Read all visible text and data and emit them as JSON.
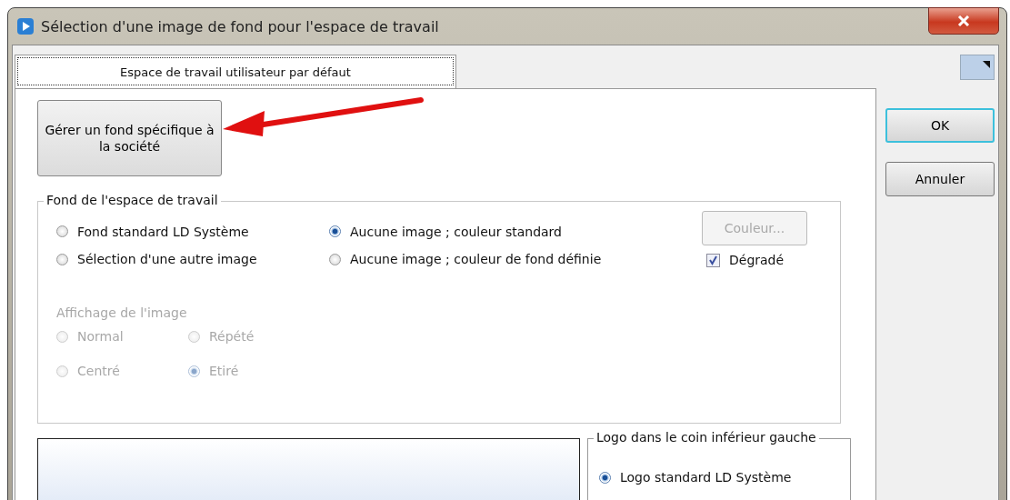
{
  "window": {
    "title": "Sélection d'une image de fond pour l'espace de travail"
  },
  "tabs": [
    {
      "label": "Espace de travail utilisateur par défaut",
      "selected": true
    }
  ],
  "manage_button": {
    "label": "Gérer un fond spécifique à la société"
  },
  "buttons": [
    {
      "label": "OK",
      "default": true
    },
    {
      "label": "Annuler",
      "default": false
    }
  ],
  "background_group": {
    "title": "Fond de l'espace de travail",
    "options": [
      {
        "label": "Fond standard LD Système",
        "selected": false
      },
      {
        "label": "Aucune image ; couleur standard",
        "selected": true
      },
      {
        "label": "Sélection d'une autre image",
        "selected": false
      },
      {
        "label": "Aucune image ; couleur de fond définie",
        "selected": false
      }
    ],
    "color_button": {
      "label": "Couleur...",
      "disabled": true
    },
    "gradient": {
      "label": "Dégradé",
      "checked": true
    },
    "display": {
      "title": "Affichage de l'image",
      "disabled": true,
      "options": [
        {
          "label": "Normal",
          "selected": false
        },
        {
          "label": "Répété",
          "selected": false
        },
        {
          "label": "Centré",
          "selected": false
        },
        {
          "label": "Etiré",
          "selected": true
        }
      ]
    }
  },
  "logo_group": {
    "title": "Logo dans le coin inférieur gauche",
    "options": [
      {
        "label": "Logo standard LD Système",
        "selected": true
      }
    ]
  }
}
